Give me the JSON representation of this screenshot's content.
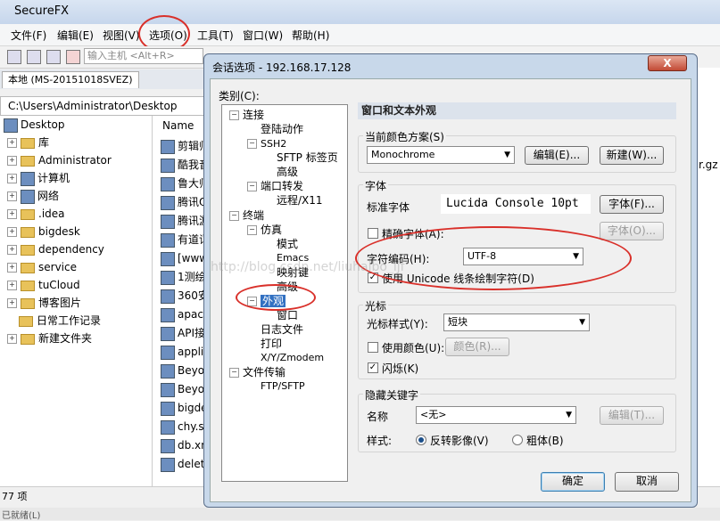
{
  "app": {
    "title": "SecureFX"
  },
  "menu": [
    "文件(F)",
    "编辑(E)",
    "视图(V)",
    "选项(O)",
    "工具(T)",
    "窗口(W)",
    "帮助(H)"
  ],
  "toolbar": {
    "host_placeholder": "输入主机 <Alt+R>"
  },
  "left": {
    "tab": "本地 (MS-20151018SVEZ)",
    "path": "C:\\Users\\Administrator\\Desktop",
    "tree": [
      "Desktop",
      "库",
      "Administrator",
      "计算机",
      "网络",
      ".idea",
      "bigdesk",
      "dependency",
      "service",
      "tuCloud",
      "博客图片",
      "日常工作记录",
      "新建文件夹"
    ],
    "name_header": "Name",
    "files": [
      "剪辑师",
      "酷我音",
      "鲁大师",
      "腾讯Q",
      "腾讯游",
      "有道词",
      "[www",
      "1测绘",
      "360安",
      "apach",
      "API接",
      "applic",
      "Beyo",
      "Beyo",
      "bigde",
      "chy.s",
      "db.xn",
      "delet"
    ],
    "status": "77 项",
    "right_fragment": "r.gz",
    "bottom_fragment": "已就绪(L)"
  },
  "dialog": {
    "title": "会话选项 - 192.168.17.128",
    "close": "X",
    "category_label": "类别(C):",
    "tree": {
      "connection": "连接",
      "login_actions": "登陆动作",
      "ssh2": "SSH2",
      "sftp_tab": "SFTP 标签页",
      "advanced1": "高级",
      "port_forward": "端口转发",
      "remote_x11": "远程/X11",
      "terminal": "终端",
      "emulation": "仿真",
      "modes": "模式",
      "emacs": "Emacs",
      "mapped_keys": "映射键",
      "advanced2": "高级",
      "appearance": "外观",
      "window": "窗口",
      "log_file": "日志文件",
      "printing": "打印",
      "xyzmodem": "X/Y/Zmodem",
      "file_transfer": "文件传输",
      "ftp_sftp": "FTP/SFTP"
    },
    "panel_title": "窗口和文本外观",
    "color_scheme": {
      "label": "当前颜色方案(S)",
      "value": "Monochrome",
      "edit": "编辑(E)...",
      "new": "新建(W)..."
    },
    "font_group": {
      "label": "字体",
      "standard_font": "标准字体",
      "font_value": "Lucida Console 10pt",
      "font_button": "字体(F)...",
      "precise_font": "精确字体(A):",
      "precise_button": "字体(O)...",
      "charset_label": "字符编码(H):",
      "charset_value": "UTF-8",
      "unicode_line": "使用 Unicode 线条绘制字符(D)"
    },
    "cursor_group": {
      "label": "光标",
      "style_label": "光标样式(Y):",
      "style_value": "短块",
      "use_color": "使用颜色(U):",
      "color_button": "颜色(R)...",
      "blink": "闪烁(K)"
    },
    "hotkey_group": {
      "label": "隐藏关键字",
      "name_label": "名称",
      "name_value": "<无>",
      "edit_button": "编辑(T)...",
      "style_label": "样式:",
      "reverse": "反转影像(V)",
      "bold": "粗体(B)"
    },
    "ok": "确定",
    "cancel": "取消"
  },
  "watermark": "http://blog.csdn.net/liuhaibo_ljf"
}
